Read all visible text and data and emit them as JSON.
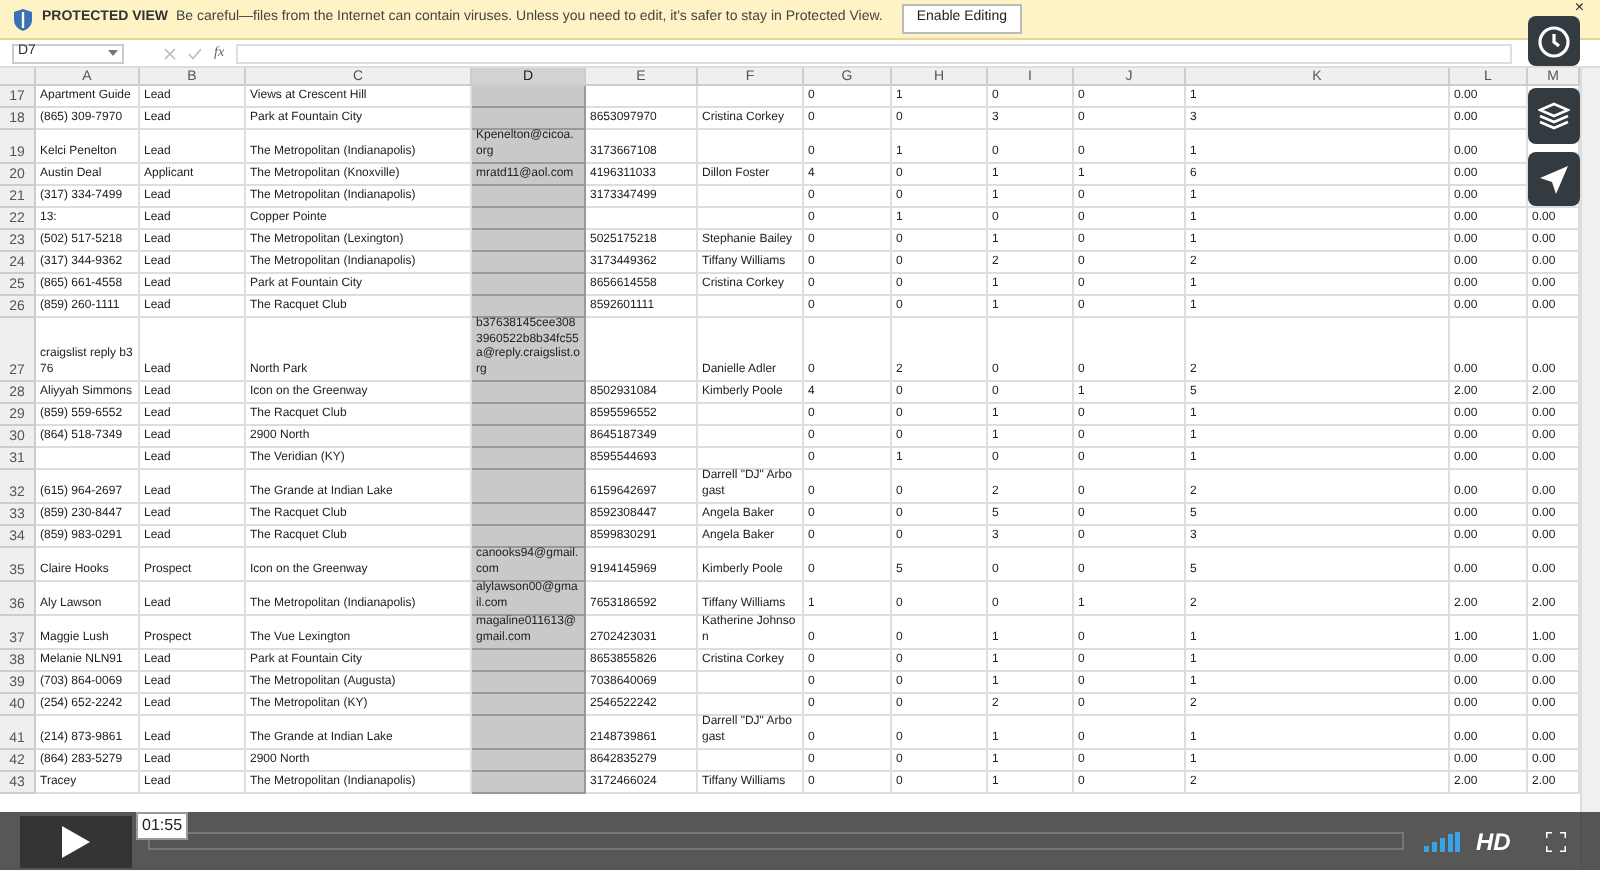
{
  "protected_view": {
    "label": "PROTECTED VIEW",
    "message": "Be careful—files from the Internet can contain viruses. Unless you need to edit, it's safer to stay in Protected View.",
    "button": "Enable Editing",
    "close": "×"
  },
  "formula_bar": {
    "name_box": "D7",
    "fx": "fx"
  },
  "columns": [
    {
      "label": "A",
      "selected": false
    },
    {
      "label": "B",
      "selected": false
    },
    {
      "label": "C",
      "selected": false
    },
    {
      "label": "D",
      "selected": true
    },
    {
      "label": "E",
      "selected": false
    },
    {
      "label": "F",
      "selected": false
    },
    {
      "label": "G",
      "selected": false
    },
    {
      "label": "H",
      "selected": false
    },
    {
      "label": "I",
      "selected": false
    },
    {
      "label": "J",
      "selected": false
    },
    {
      "label": "K",
      "selected": false
    },
    {
      "label": "L",
      "selected": false
    },
    {
      "label": "M",
      "selected": false
    }
  ],
  "rows": [
    {
      "number": "17",
      "cells": {
        "A": "Apartment Guide",
        "B": "Lead",
        "C": "Views at Crescent Hill",
        "G": "0",
        "H": "1",
        "I": "0",
        "J": "0",
        "K": "1",
        "L": "0.00"
      }
    },
    {
      "number": "18",
      "cells": {
        "A": "(865) 309-7970",
        "B": "Lead",
        "C": "Park at Fountain City",
        "E": "8653097970",
        "F": "Cristina Corkey",
        "G": "0",
        "H": "0",
        "I": "3",
        "J": "0",
        "K": "3",
        "L": "0.00"
      }
    },
    {
      "number": "19",
      "cells": {
        "A": "Kelci Penelton",
        "B": "Lead",
        "C": "The Metropolitan (Indianapolis)",
        "D": "Kpenelton@cicoa.org",
        "E": "3173667108",
        "G": "0",
        "H": "1",
        "I": "0",
        "J": "0",
        "K": "1",
        "L": "0.00"
      }
    },
    {
      "number": "20",
      "cells": {
        "A": "Austin Deal",
        "B": "Applicant",
        "C": "The Metropolitan (Knoxville)",
        "D": "mratd11@aol.com",
        "E": "4196311033",
        "F": "Dillon Foster",
        "G": "4",
        "H": "0",
        "I": "1",
        "J": "1",
        "K": "6",
        "L": "0.00"
      }
    },
    {
      "number": "21",
      "cells": {
        "A": "(317) 334-7499",
        "B": "Lead",
        "C": "The Metropolitan (Indianapolis)",
        "E": "3173347499",
        "G": "0",
        "H": "0",
        "I": "1",
        "J": "0",
        "K": "1",
        "L": "0.00"
      }
    },
    {
      "number": "22",
      "cells": {
        "A": "13:",
        "B": "Lead",
        "C": "Copper Pointe",
        "G": "0",
        "H": "1",
        "I": "0",
        "J": "0",
        "K": "1",
        "L": "0.00",
        "M": "0.00"
      }
    },
    {
      "number": "23",
      "cells": {
        "A": "(502) 517-5218",
        "B": "Lead",
        "C": "The Metropolitan (Lexington)",
        "E": "5025175218",
        "F": "Stephanie Bailey",
        "G": "0",
        "H": "0",
        "I": "1",
        "J": "0",
        "K": "1",
        "L": "0.00",
        "M": "0.00"
      }
    },
    {
      "number": "24",
      "cells": {
        "A": "(317) 344-9362",
        "B": "Lead",
        "C": "The Metropolitan (Indianapolis)",
        "E": "3173449362",
        "F": "Tiffany Williams",
        "G": "0",
        "H": "0",
        "I": "2",
        "J": "0",
        "K": "2",
        "L": "0.00",
        "M": "0.00"
      }
    },
    {
      "number": "25",
      "cells": {
        "A": "(865) 661-4558",
        "B": "Lead",
        "C": "Park at Fountain City",
        "E": "8656614558",
        "F": "Cristina Corkey",
        "G": "0",
        "H": "0",
        "I": "1",
        "J": "0",
        "K": "1",
        "L": "0.00",
        "M": "0.00"
      }
    },
    {
      "number": "26",
      "cells": {
        "A": "(859) 260-1111",
        "B": "Lead",
        "C": "The Racquet Club",
        "E": "8592601111",
        "G": "0",
        "H": "0",
        "I": "1",
        "J": "0",
        "K": "1",
        "L": "0.00",
        "M": "0.00"
      }
    },
    {
      "number": "27",
      "cells": {
        "A": "craigslist reply b376",
        "B": "Lead",
        "C": "North Park",
        "D": "b37638145cee3083960522b8b34fc55a@reply.craigslist.org",
        "F": "Danielle Adler",
        "G": "0",
        "H": "2",
        "I": "0",
        "J": "0",
        "K": "2",
        "L": "0.00",
        "M": "0.00"
      }
    },
    {
      "number": "28",
      "cells": {
        "A": "Aliyyah Simmons",
        "B": "Lead",
        "C": "Icon on the Greenway",
        "E": "8502931084",
        "F": "Kimberly Poole",
        "G": "4",
        "H": "0",
        "I": "0",
        "J": "1",
        "K": "5",
        "L": "2.00",
        "M": "2.00"
      }
    },
    {
      "number": "29",
      "cells": {
        "A": "(859) 559-6552",
        "B": "Lead",
        "C": "The Racquet Club",
        "E": "8595596552",
        "G": "0",
        "H": "0",
        "I": "1",
        "J": "0",
        "K": "1",
        "L": "0.00",
        "M": "0.00"
      }
    },
    {
      "number": "30",
      "cells": {
        "A": "(864) 518-7349",
        "B": "Lead",
        "C": "2900 North",
        "E": "8645187349",
        "G": "0",
        "H": "0",
        "I": "1",
        "J": "0",
        "K": "1",
        "L": "0.00",
        "M": "0.00"
      }
    },
    {
      "number": "31",
      "cells": {
        "B": "Lead",
        "C": "The Veridian (KY)",
        "E": "8595544693",
        "G": "0",
        "H": "1",
        "I": "0",
        "J": "0",
        "K": "1",
        "L": "0.00",
        "M": "0.00"
      }
    },
    {
      "number": "32",
      "cells": {
        "A": "(615) 964-2697",
        "B": "Lead",
        "C": "The Grande at Indian Lake",
        "E": "6159642697",
        "F": "Darrell \"DJ\" Arbogast",
        "G": "0",
        "H": "0",
        "I": "2",
        "J": "0",
        "K": "2",
        "L": "0.00",
        "M": "0.00"
      }
    },
    {
      "number": "33",
      "cells": {
        "A": "(859) 230-8447",
        "B": "Lead",
        "C": "The Racquet Club",
        "E": "8592308447",
        "F": "Angela Baker",
        "G": "0",
        "H": "0",
        "I": "5",
        "J": "0",
        "K": "5",
        "L": "0.00",
        "M": "0.00"
      }
    },
    {
      "number": "34",
      "cells": {
        "A": "(859) 983-0291",
        "B": "Lead",
        "C": "The Racquet Club",
        "E": "8599830291",
        "F": "Angela Baker",
        "G": "0",
        "H": "0",
        "I": "3",
        "J": "0",
        "K": "3",
        "L": "0.00",
        "M": "0.00"
      }
    },
    {
      "number": "35",
      "cells": {
        "A": "Claire Hooks",
        "B": "Prospect",
        "C": "Icon on the Greenway",
        "D": "canooks94@gmail.com",
        "E": "9194145969",
        "F": "Kimberly Poole",
        "G": "0",
        "H": "5",
        "I": "0",
        "J": "0",
        "K": "5",
        "L": "0.00",
        "M": "0.00"
      }
    },
    {
      "number": "36",
      "cells": {
        "A": "Aly Lawson",
        "B": "Lead",
        "C": "The Metropolitan (Indianapolis)",
        "D": "alylawson00@gmail.com",
        "E": "7653186592",
        "F": "Tiffany Williams",
        "G": "1",
        "H": "0",
        "I": "0",
        "J": "1",
        "K": "2",
        "L": "2.00",
        "M": "2.00"
      }
    },
    {
      "number": "37",
      "cells": {
        "A": "Maggie Lush",
        "B": "Prospect",
        "C": "The Vue Lexington",
        "D": "magaline011613@gmail.com",
        "E": "2702423031",
        "F": "Katherine Johnson",
        "G": "0",
        "H": "0",
        "I": "1",
        "J": "0",
        "K": "1",
        "L": "1.00",
        "M": "1.00"
      }
    },
    {
      "number": "38",
      "cells": {
        "A": "Melanie NLN91",
        "B": "Lead",
        "C": "Park at Fountain City",
        "E": "8653855826",
        "F": "Cristina Corkey",
        "G": "0",
        "H": "0",
        "I": "1",
        "J": "0",
        "K": "1",
        "L": "0.00",
        "M": "0.00"
      }
    },
    {
      "number": "39",
      "cells": {
        "A": "(703) 864-0069",
        "B": "Lead",
        "C": "The Metropolitan (Augusta)",
        "E": "7038640069",
        "G": "0",
        "H": "0",
        "I": "1",
        "J": "0",
        "K": "1",
        "L": "0.00",
        "M": "0.00"
      }
    },
    {
      "number": "40",
      "cells": {
        "A": "(254) 652-2242",
        "B": "Lead",
        "C": "The Metropolitan (KY)",
        "E": "2546522242",
        "G": "0",
        "H": "0",
        "I": "2",
        "J": "0",
        "K": "2",
        "L": "0.00",
        "M": "0.00"
      }
    },
    {
      "number": "41",
      "cells": {
        "A": "(214) 873-9861",
        "B": "Lead",
        "C": "The Grande at Indian Lake",
        "E": "2148739861",
        "F": "Darrell \"DJ\" Arbogast",
        "G": "0",
        "H": "0",
        "I": "1",
        "J": "0",
        "K": "1",
        "L": "0.00",
        "M": "0.00"
      }
    },
    {
      "number": "42",
      "cells": {
        "A": "(864) 283-5279",
        "B": "Lead",
        "C": "2900 North",
        "E": "8642835279",
        "G": "0",
        "H": "0",
        "I": "1",
        "J": "0",
        "K": "1",
        "L": "0.00",
        "M": "0.00"
      }
    },
    {
      "number": "43",
      "cells": {
        "A": "Tracey",
        "B": "Lead",
        "C": "The Metropolitan (Indianapolis)",
        "E": "3172466024",
        "F": "Tiffany Williams",
        "G": "0",
        "H": "0",
        "I": "1",
        "J": "0",
        "K": "2",
        "L": "2.00",
        "M": "2.00"
      }
    }
  ],
  "player": {
    "time": "01:55",
    "quality": "HD"
  }
}
